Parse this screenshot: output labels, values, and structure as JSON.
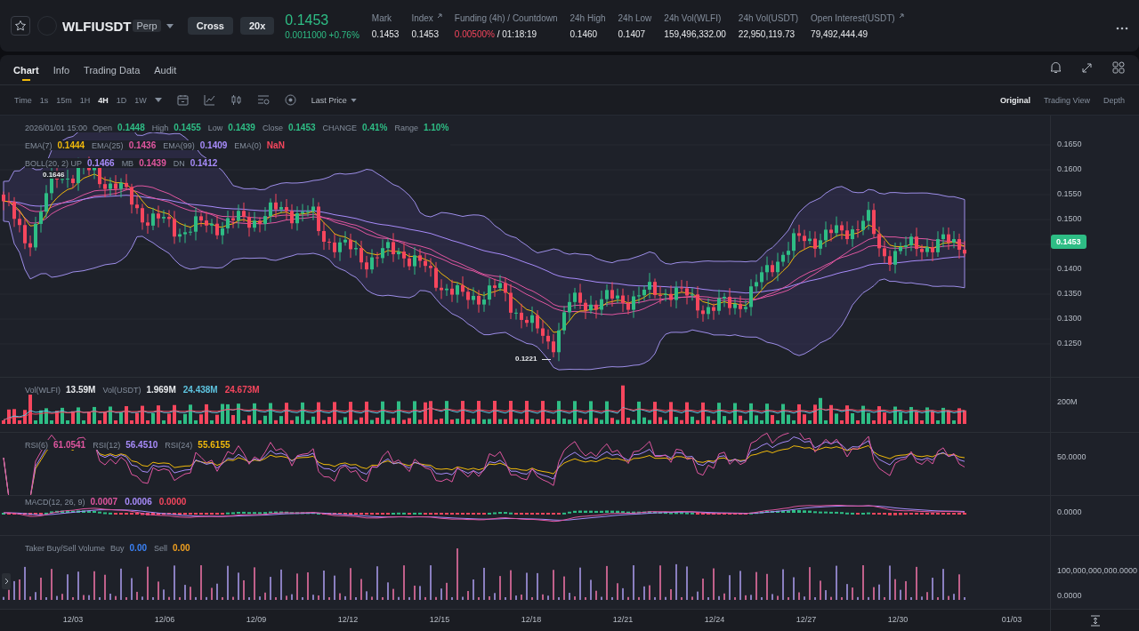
{
  "header": {
    "symbol": "WLFIUSDT",
    "contract_badge": "Perp",
    "margin_mode": "Cross",
    "leverage": "20x",
    "last_price": "0.1453",
    "change": "0.0011000 +0.76%",
    "stats": [
      {
        "label": "Mark",
        "value": "0.1453",
        "kind": "plain",
        "info_icon": false
      },
      {
        "label": "Index",
        "value": "0.1453",
        "kind": "plain",
        "info_icon": true
      },
      {
        "label": "Funding (4h) / Countdown",
        "value": "0.00500%",
        "value_extra": "/ 01:18:19",
        "kind": "funding",
        "info_icon": false
      },
      {
        "label": "24h High",
        "value": "0.1460",
        "kind": "plain",
        "info_icon": false
      },
      {
        "label": "24h Low",
        "value": "0.1407",
        "kind": "plain",
        "info_icon": false
      },
      {
        "label": "24h Vol(WLFI)",
        "value": "159,496,332.00",
        "kind": "plain",
        "info_icon": false
      },
      {
        "label": "24h Vol(USDT)",
        "value": "22,950,119.73",
        "kind": "plain",
        "info_icon": false
      },
      {
        "label": "Open Interest(USDT)",
        "value": "79,492,444.49",
        "kind": "plain",
        "info_icon": true
      }
    ]
  },
  "tabs": [
    {
      "label": "Chart",
      "selected": true
    },
    {
      "label": "Info",
      "selected": false
    },
    {
      "label": "Trading Data",
      "selected": false
    },
    {
      "label": "Audit",
      "selected": false
    }
  ],
  "toolbar": {
    "time_label": "Time",
    "intervals": [
      {
        "label": "1s",
        "selected": false
      },
      {
        "label": "15m",
        "selected": false
      },
      {
        "label": "1H",
        "selected": false
      },
      {
        "label": "4H",
        "selected": true
      },
      {
        "label": "1D",
        "selected": false
      },
      {
        "label": "1W",
        "selected": false
      }
    ],
    "price_type": "Last Price",
    "view_modes": [
      {
        "label": "Original",
        "selected": true
      },
      {
        "label": "Trading View",
        "selected": false
      },
      {
        "label": "Depth",
        "selected": false
      }
    ]
  },
  "main_legend": [
    {
      "title": "2026/01/01 15:00",
      "items": [
        {
          "label": "Open",
          "value": "0.1448",
          "color": "#2ebd85"
        },
        {
          "label": "High",
          "value": "0.1455",
          "color": "#2ebd85"
        },
        {
          "label": "Low",
          "value": "0.1439",
          "color": "#2ebd85"
        },
        {
          "label": "Close",
          "value": "0.1453",
          "color": "#2ebd85"
        },
        {
          "label": "CHANGE",
          "value": "0.41%",
          "color": "#2ebd85"
        },
        {
          "label": "Range",
          "value": "1.10%",
          "color": "#2ebd85"
        }
      ]
    },
    {
      "items": [
        {
          "label": "EMA(7)",
          "value": "0.1444",
          "color": "#f0b90b"
        },
        {
          "label": "EMA(25)",
          "value": "0.1436",
          "color": "#e056a0"
        },
        {
          "label": "EMA(99)",
          "value": "0.1409",
          "color": "#a78bfa"
        },
        {
          "label": "EMA(0)",
          "value": "NaN",
          "color": "#f6465d"
        }
      ]
    },
    {
      "items": [
        {
          "label": "BOLL(20, 2) UP",
          "value": "0.1466",
          "color": "#a78bfa"
        },
        {
          "label": "MB",
          "value": "0.1439",
          "color": "#e056a0"
        },
        {
          "label": "DN",
          "value": "0.1412",
          "color": "#a78bfa"
        }
      ]
    }
  ],
  "price_axis": [
    "0.1650",
    "0.1600",
    "0.1550",
    "0.1500",
    "0.1400",
    "0.1350",
    "0.1300",
    "0.1250"
  ],
  "current_price_tag": "0.1453",
  "high_marker": "0.1646",
  "low_marker": "0.1221",
  "panes": [
    {
      "kind": "volume",
      "legend": [
        {
          "label": "Vol(WLFI)",
          "value": "13.59M",
          "color": "#eaecef"
        },
        {
          "label": "Vol(USDT)",
          "value": "1.969M",
          "color": "#eaecef"
        },
        {
          "value": "24.438M",
          "color": "#5ec4e0"
        },
        {
          "value": "24.673M",
          "color": "#f6465d"
        }
      ],
      "axis_labels": [
        "200M"
      ]
    },
    {
      "kind": "rsi",
      "legend": [
        {
          "label": "RSI(6)",
          "value": "61.0541",
          "color": "#e056a0"
        },
        {
          "label": "RSI(12)",
          "value": "56.4510",
          "color": "#a78bfa"
        },
        {
          "label": "RSI(24)",
          "value": "55.6155",
          "color": "#f0b90b"
        }
      ],
      "axis_labels": [
        "50.0000"
      ]
    },
    {
      "kind": "macd",
      "legend": [
        {
          "label": "MACD(12, 26, 9)",
          "value": "0.0007",
          "color": "#e056a0"
        },
        {
          "value": "0.0006",
          "color": "#a78bfa"
        },
        {
          "value": "0.0000",
          "color": "#f6465d"
        }
      ],
      "axis_labels": [
        "0.0000"
      ]
    },
    {
      "kind": "taker",
      "legend": [
        {
          "label": "Taker Buy/Sell Volume"
        },
        {
          "label": "Buy",
          "value": "0.00",
          "color": "#3b82f6"
        },
        {
          "label": "Sell",
          "value": "0.00",
          "color": "#f0a020"
        }
      ],
      "axis_labels": [
        "100,000,000,000.0000",
        "0.0000"
      ]
    }
  ],
  "x_axis": [
    "12/03",
    "12/06",
    "12/09",
    "12/12",
    "12/15",
    "12/18",
    "12/21",
    "12/24",
    "12/27",
    "12/30",
    "01/03"
  ]
}
